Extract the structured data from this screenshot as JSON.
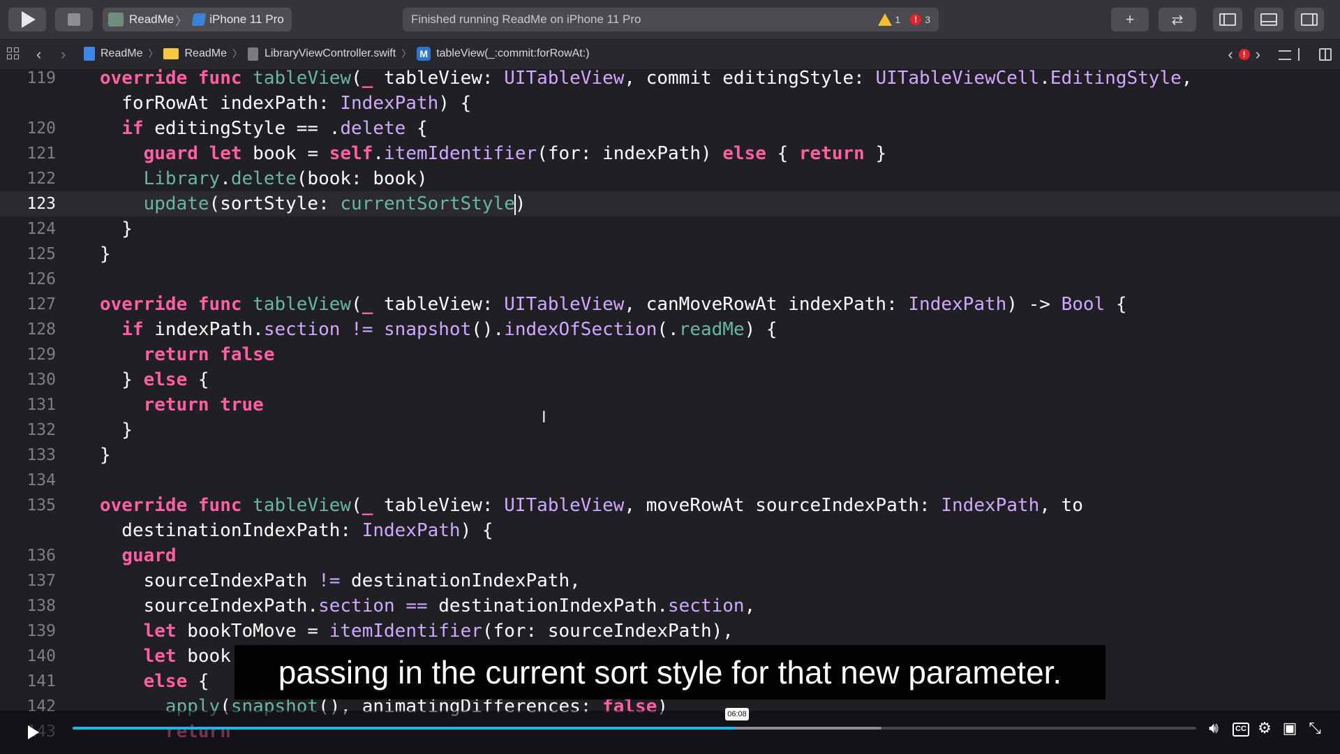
{
  "toolbar": {
    "scheme_project": "ReadMe",
    "scheme_device": "iPhone 11 Pro",
    "status_text": "Finished running ReadMe on iPhone 11 Pro",
    "warning_count": "1",
    "error_count": "3"
  },
  "jumpbar": {
    "crumbs": [
      "ReadMe",
      "ReadMe",
      "LibraryViewController.swift",
      "tableView(_:commit:forRowAt:)"
    ],
    "method_badge": "M",
    "error_mark": "!"
  },
  "editor": {
    "current_line": "123",
    "lines": [
      {
        "n": "119",
        "tokens": [
          [
            "kw",
            "override"
          ],
          [
            "pl",
            " "
          ],
          [
            "kw",
            "func"
          ],
          [
            "pl",
            " "
          ],
          [
            "fn",
            "tableView"
          ],
          [
            "pl",
            "("
          ],
          [
            "kw",
            "_"
          ],
          [
            "pl",
            " tableView: "
          ],
          [
            "ty",
            "UITableView"
          ],
          [
            "pl",
            ", commit editingStyle: "
          ],
          [
            "ty",
            "UITableViewCell"
          ],
          [
            "pl",
            "."
          ],
          [
            "ty",
            "EditingStyle"
          ],
          [
            "pl",
            ","
          ]
        ]
      },
      {
        "n": "",
        "tokens": [
          [
            "pl",
            "  forRowAt indexPath: "
          ],
          [
            "ty",
            "IndexPath"
          ],
          [
            "pl",
            ") {"
          ]
        ]
      },
      {
        "n": "120",
        "tokens": [
          [
            "pl",
            "  "
          ],
          [
            "kw",
            "if"
          ],
          [
            "pl",
            " editingStyle == ."
          ],
          [
            "ty",
            "delete"
          ],
          [
            "pl",
            " {"
          ]
        ]
      },
      {
        "n": "121",
        "tokens": [
          [
            "pl",
            "    "
          ],
          [
            "kw",
            "guard"
          ],
          [
            "pl",
            " "
          ],
          [
            "kw",
            "let"
          ],
          [
            "pl",
            " book = "
          ],
          [
            "kw",
            "self"
          ],
          [
            "pl",
            "."
          ],
          [
            "ty",
            "itemIdentifier"
          ],
          [
            "pl",
            "(for: indexPath) "
          ],
          [
            "kw",
            "else"
          ],
          [
            "pl",
            " { "
          ],
          [
            "kw",
            "return"
          ],
          [
            "pl",
            " }"
          ]
        ]
      },
      {
        "n": "122",
        "tokens": [
          [
            "pl",
            "    "
          ],
          [
            "fn",
            "Library"
          ],
          [
            "pl",
            "."
          ],
          [
            "fn",
            "delete"
          ],
          [
            "pl",
            "(book: book)"
          ]
        ]
      },
      {
        "n": "123",
        "tokens": [
          [
            "pl",
            "    "
          ],
          [
            "fn",
            "update"
          ],
          [
            "pl",
            "(sortStyle: "
          ],
          [
            "fn",
            "currentSortStyle"
          ],
          [
            "cur",
            ""
          ],
          [
            "pl",
            ")"
          ]
        ]
      },
      {
        "n": "124",
        "tokens": [
          [
            "pl",
            "  }"
          ]
        ]
      },
      {
        "n": "125",
        "tokens": [
          [
            "pl",
            "}"
          ]
        ]
      },
      {
        "n": "126",
        "tokens": []
      },
      {
        "n": "127",
        "tokens": [
          [
            "kw",
            "override"
          ],
          [
            "pl",
            " "
          ],
          [
            "kw",
            "func"
          ],
          [
            "pl",
            " "
          ],
          [
            "fn",
            "tableView"
          ],
          [
            "pl",
            "("
          ],
          [
            "kw",
            "_"
          ],
          [
            "pl",
            " tableView: "
          ],
          [
            "ty",
            "UITableView"
          ],
          [
            "pl",
            ", canMoveRowAt indexPath: "
          ],
          [
            "ty",
            "IndexPath"
          ],
          [
            "pl",
            ") -> "
          ],
          [
            "ty",
            "Bool"
          ],
          [
            "pl",
            " {"
          ]
        ]
      },
      {
        "n": "128",
        "tokens": [
          [
            "pl",
            "  "
          ],
          [
            "kw",
            "if"
          ],
          [
            "pl",
            " indexPath."
          ],
          [
            "ty",
            "section"
          ],
          [
            "pl",
            " "
          ],
          [
            "ty",
            "!="
          ],
          [
            "pl",
            " "
          ],
          [
            "ty",
            "snapshot"
          ],
          [
            "pl",
            "()."
          ],
          [
            "ty",
            "indexOfSection"
          ],
          [
            "pl",
            "(."
          ],
          [
            "fn",
            "readMe"
          ],
          [
            "pl",
            ") {"
          ]
        ]
      },
      {
        "n": "129",
        "tokens": [
          [
            "pl",
            "    "
          ],
          [
            "kw",
            "return"
          ],
          [
            "pl",
            " "
          ],
          [
            "kw",
            "false"
          ]
        ]
      },
      {
        "n": "130",
        "tokens": [
          [
            "pl",
            "  } "
          ],
          [
            "kw",
            "else"
          ],
          [
            "pl",
            " {"
          ]
        ]
      },
      {
        "n": "131",
        "tokens": [
          [
            "pl",
            "    "
          ],
          [
            "kw",
            "return"
          ],
          [
            "pl",
            " "
          ],
          [
            "kw",
            "true"
          ]
        ]
      },
      {
        "n": "132",
        "tokens": [
          [
            "pl",
            "  }"
          ]
        ]
      },
      {
        "n": "133",
        "tokens": [
          [
            "pl",
            "}"
          ]
        ]
      },
      {
        "n": "134",
        "tokens": []
      },
      {
        "n": "135",
        "tokens": [
          [
            "kw",
            "override"
          ],
          [
            "pl",
            " "
          ],
          [
            "kw",
            "func"
          ],
          [
            "pl",
            " "
          ],
          [
            "fn",
            "tableView"
          ],
          [
            "pl",
            "("
          ],
          [
            "kw",
            "_"
          ],
          [
            "pl",
            " tableView: "
          ],
          [
            "ty",
            "UITableView"
          ],
          [
            "pl",
            ", moveRowAt sourceIndexPath: "
          ],
          [
            "ty",
            "IndexPath"
          ],
          [
            "pl",
            ", to"
          ]
        ]
      },
      {
        "n": "",
        "tokens": [
          [
            "pl",
            "  destinationIndexPath: "
          ],
          [
            "ty",
            "IndexPath"
          ],
          [
            "pl",
            ") {"
          ]
        ]
      },
      {
        "n": "136",
        "tokens": [
          [
            "pl",
            "  "
          ],
          [
            "kw",
            "guard"
          ]
        ]
      },
      {
        "n": "137",
        "tokens": [
          [
            "pl",
            "    sourceIndexPath "
          ],
          [
            "ty",
            "!="
          ],
          [
            "pl",
            " destinationIndexPath,"
          ]
        ]
      },
      {
        "n": "138",
        "tokens": [
          [
            "pl",
            "    sourceIndexPath."
          ],
          [
            "ty",
            "section"
          ],
          [
            "pl",
            " "
          ],
          [
            "ty",
            "=="
          ],
          [
            "pl",
            " destinationIndexPath."
          ],
          [
            "ty",
            "section"
          ],
          [
            "pl",
            ","
          ]
        ]
      },
      {
        "n": "139",
        "tokens": [
          [
            "pl",
            "    "
          ],
          [
            "kw",
            "let"
          ],
          [
            "pl",
            " bookToMove = "
          ],
          [
            "ty",
            "itemIdentifier"
          ],
          [
            "pl",
            "(for: sourceIndexPath),"
          ]
        ]
      },
      {
        "n": "140",
        "tokens": [
          [
            "pl",
            "    "
          ],
          [
            "kw",
            "let"
          ],
          [
            "pl",
            " book"
          ]
        ]
      },
      {
        "n": "141",
        "tokens": [
          [
            "pl",
            "    "
          ],
          [
            "kw",
            "else"
          ],
          [
            "pl",
            " {"
          ]
        ]
      },
      {
        "n": "142",
        "tokens": [
          [
            "pl",
            "      "
          ],
          [
            "fn",
            "apply"
          ],
          [
            "pl",
            "("
          ],
          [
            "fn",
            "snapshot"
          ],
          [
            "pl",
            "(), animatingDifferences: "
          ],
          [
            "kw",
            "false"
          ],
          [
            "pl",
            ")"
          ]
        ]
      },
      {
        "n": "143",
        "tokens": [
          [
            "pl",
            "      "
          ],
          [
            "kw",
            "return"
          ]
        ]
      }
    ]
  },
  "caption": {
    "text": "passing in the current sort style for that new parameter."
  },
  "video": {
    "time_tip": "06:08",
    "progress": 0.59,
    "buffered": 0.72
  },
  "icons": {
    "play": "play-icon",
    "stop": "stop-icon",
    "volume": "volume-icon",
    "cc": "captions-icon",
    "settings": "gear-icon",
    "pip": "picture-in-picture-icon",
    "fullscreen": "fullscreen-icon"
  }
}
